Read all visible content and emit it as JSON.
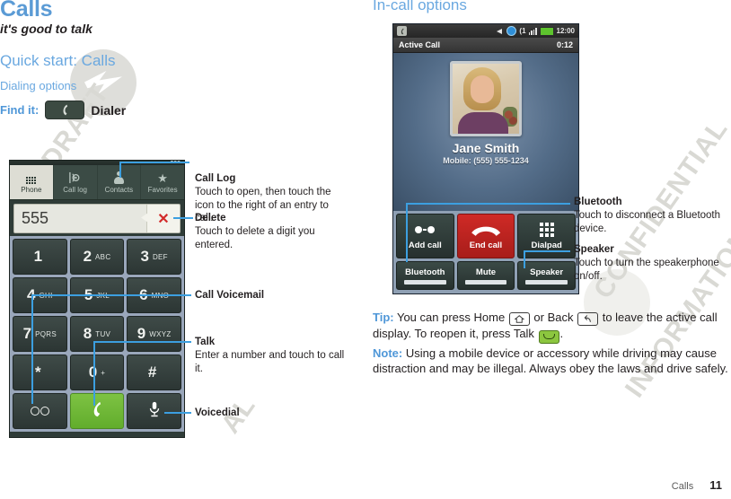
{
  "doc": {
    "title": "Calls",
    "subtitle": "it's good to talk",
    "section": "Quick start: Calls",
    "subsection": "Dialing options",
    "find_label": "Find it:",
    "find_app": "Dialer",
    "phone_chip_icon": "handset-icon"
  },
  "watermark": {
    "line1": "DRAFT",
    "line2": "AL",
    "line3": "CONFIDENTIAL",
    "line4": "INFORMATION"
  },
  "dialer": {
    "tabs": [
      {
        "label": "Phone",
        "icon": "keypad-icon",
        "active": true
      },
      {
        "label": "Call log",
        "icon": "call-log-icon",
        "active": false
      },
      {
        "label": "Contacts",
        "icon": "person-icon",
        "active": false
      },
      {
        "label": "Favorites",
        "icon": "star-icon",
        "active": false
      }
    ],
    "input_value": "555",
    "delete_icon": "x-icon",
    "keys": [
      {
        "digit": "1",
        "letters": ""
      },
      {
        "digit": "2",
        "letters": "ABC"
      },
      {
        "digit": "3",
        "letters": "DEF"
      },
      {
        "digit": "4",
        "letters": "GHI"
      },
      {
        "digit": "5",
        "letters": "JKL"
      },
      {
        "digit": "6",
        "letters": "MNO"
      },
      {
        "digit": "7",
        "letters": "PQRS"
      },
      {
        "digit": "8",
        "letters": "TUV"
      },
      {
        "digit": "9",
        "letters": "WXYZ"
      },
      {
        "digit": "*",
        "letters": ""
      },
      {
        "digit": "0",
        "letters": "+"
      },
      {
        "digit": "#",
        "letters": ""
      }
    ],
    "bottom_keys": [
      {
        "name": "voicemail-key",
        "icon": "voicemail-icon"
      },
      {
        "name": "call-key",
        "icon": "handset-icon"
      },
      {
        "name": "voicedial-key",
        "icon": "microphone-icon"
      }
    ]
  },
  "callouts_left": [
    {
      "heading": "Call Log",
      "body": "Touch to open, then touch the icon to the right of an entry to call."
    },
    {
      "heading": "Delete",
      "body": "Touch to delete a digit you entered."
    },
    {
      "heading": "Call Voicemail",
      "body": ""
    },
    {
      "heading": "Talk",
      "body": "Enter a number and touch to call it."
    },
    {
      "heading": "Voicedial",
      "body": ""
    }
  ],
  "incall": {
    "section": "In-call options",
    "status": {
      "left_icon": "handset-icon",
      "icons": [
        "speaker-icon",
        "globe-icon",
        "call-indicator-icon",
        "signal-bars-icon",
        "battery-icon"
      ],
      "time": "12:00"
    },
    "title": "Active Call",
    "duration": "0:12",
    "contact_name": "Jane Smith",
    "contact_number": "Mobile:  (555) 555-1234",
    "photo": "contact-photo",
    "actions": [
      {
        "label": "Add call",
        "icon": "add-call-icon"
      },
      {
        "label": "End call",
        "icon": "end-call-icon"
      },
      {
        "label": "Dialpad",
        "icon": "dialpad-icon"
      }
    ],
    "toggles": [
      {
        "label": "Bluetooth"
      },
      {
        "label": "Mute"
      },
      {
        "label": "Speaker"
      }
    ]
  },
  "callouts_right": [
    {
      "heading": "Bluetooth",
      "body": "Touch to disconnect a Bluetooth device."
    },
    {
      "heading": "Speaker",
      "body": "Touch to turn the speakerphone on/off."
    }
  ],
  "tip": {
    "lead": "Tip:",
    "part1": " You can press Home ",
    "part2": " or Back ",
    "part3": " to leave the active call display. To reopen it, press Talk ",
    "part4": ".",
    "home_icon": "home-icon",
    "back_icon": "back-icon",
    "talk_icon": "talk-icon"
  },
  "note": {
    "lead": "Note:",
    "body": " Using a mobile device or accessory while driving may cause distraction and may be illegal. Always obey the laws and drive safely."
  },
  "footer": {
    "label": "Calls",
    "page": "11"
  },
  "colors": {
    "accent": "#4f97d8",
    "heading": "#6aa8e0",
    "leader": "#3c9fe0",
    "green": "#7dc243",
    "red": "#cf2a26"
  }
}
